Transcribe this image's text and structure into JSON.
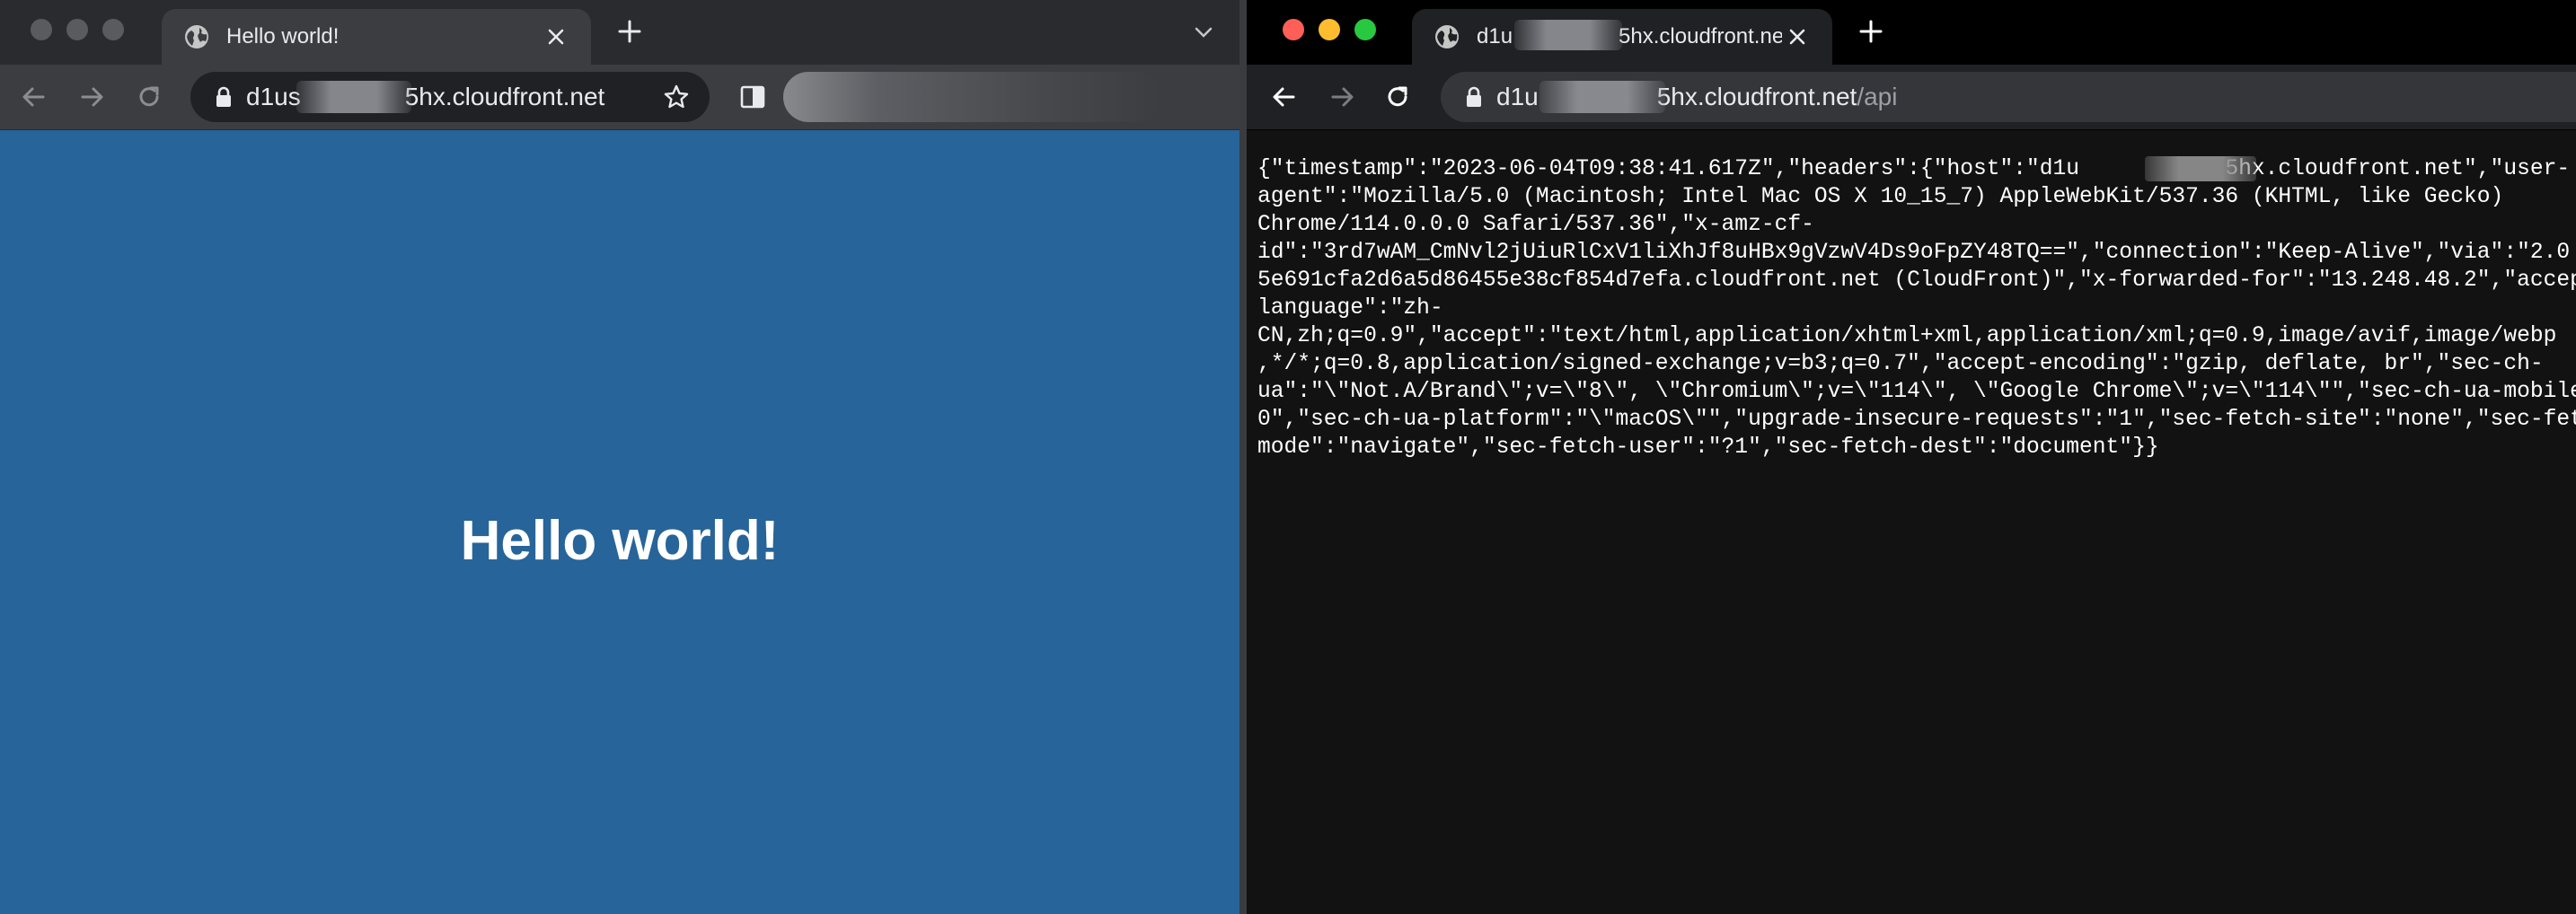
{
  "colors": {
    "traffic_inactive": "#5a5b5e",
    "traffic_close": "#ff5f57",
    "traffic_minimize": "#febc2e",
    "traffic_zoom": "#28c840",
    "page_background": "#276499",
    "json_background": "#121212"
  },
  "left_window": {
    "tab": {
      "title": "Hello world!",
      "icon": "globe-icon"
    },
    "toolbar": {
      "url_prefix": "d1us",
      "url_suffix": "5hx.cloudfront.net"
    },
    "page": {
      "heading": "Hello world!"
    }
  },
  "right_window": {
    "tab": {
      "title": "d1u",
      "title_suffix": "5hx.cloudfront.ne",
      "icon": "globe-icon"
    },
    "toolbar": {
      "url_prefix": "d1u",
      "url_suffix": "5hx.cloudfront.net",
      "url_path": "/api"
    },
    "page": {
      "json_text": "{\"timestamp\":\"2023-06-04T09:38:41.617Z\",\"headers\":{\"host\":\"d1u           5hx.cloudfront.net\",\"user-\nagent\":\"Mozilla/5.0 (Macintosh; Intel Mac OS X 10_15_7) AppleWebKit/537.36 (KHTML, like Gecko)\nChrome/114.0.0.0 Safari/537.36\",\"x-amz-cf-\nid\":\"3rd7wAM_CmNvl2jUiuRlCxV1liXhJf8uHBx9gVzwV4Ds9oFpZY48TQ==\",\"connection\":\"Keep-Alive\",\"via\":\"2.0\n5e691cfa2d6a5d86455e38cf854d7efa.cloudfront.net (CloudFront)\",\"x-forwarded-for\":\"13.248.48.2\",\"accept-\nlanguage\":\"zh-\nCN,zh;q=0.9\",\"accept\":\"text/html,application/xhtml+xml,application/xml;q=0.9,image/avif,image/webp\n,*/*;q=0.8,application/signed-exchange;v=b3;q=0.7\",\"accept-encoding\":\"gzip, deflate, br\",\"sec-ch-\nua\":\"\\\"Not.A/Brand\\\";v=\\\"8\\\", \\\"Chromium\\\";v=\\\"114\\\", \\\"Google Chrome\\\";v=\\\"114\\\"\",\"sec-ch-ua-mobile\":\"?\n0\",\"sec-ch-ua-platform\":\"\\\"macOS\\\"\",\"upgrade-insecure-requests\":\"1\",\"sec-fetch-site\":\"none\",\"sec-fetch-\nmode\":\"navigate\",\"sec-fetch-user\":\"?1\",\"sec-fetch-dest\":\"document\"}}"
    }
  }
}
